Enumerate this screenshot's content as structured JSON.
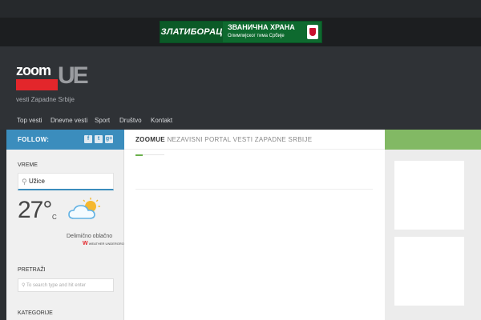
{
  "banner": {
    "brand": "ЗЛАТИБОРАЦ",
    "line1": "ЗВАНИЧНА ХРАНА",
    "line2": "Олимпијског тима Србије"
  },
  "logo": {
    "zoom": "zoom",
    "ue": "UE"
  },
  "tagline": "vesti Zapadne Srbije",
  "nav": [
    "Top vesti",
    "Dnevne vesti",
    "Sport",
    "Društvo",
    "Kontakt"
  ],
  "follow": {
    "label": "FOLLOW:",
    "icons": [
      "facebook-icon",
      "twitter-icon",
      "google-plus-icon"
    ]
  },
  "sidebar": {
    "weather_label": "VREME",
    "city": "Užice",
    "temperature": "27°",
    "unit": "C",
    "condition": "Delimično oblačno",
    "provider": "WEATHER UNDERGROUND",
    "search_label": "PRETRAŽI",
    "search_placeholder": "To search type and hit enter",
    "categories_label": "KATEGORIJE"
  },
  "main": {
    "brand": "ZOOMUE",
    "subtitle": "NEZAVISNI PORTAL VESTI ZAPADNE SRBIJE"
  },
  "colors": {
    "follow": "#3b8dbd",
    "rightbar": "#82b964",
    "logo_red": "#e3262b"
  }
}
